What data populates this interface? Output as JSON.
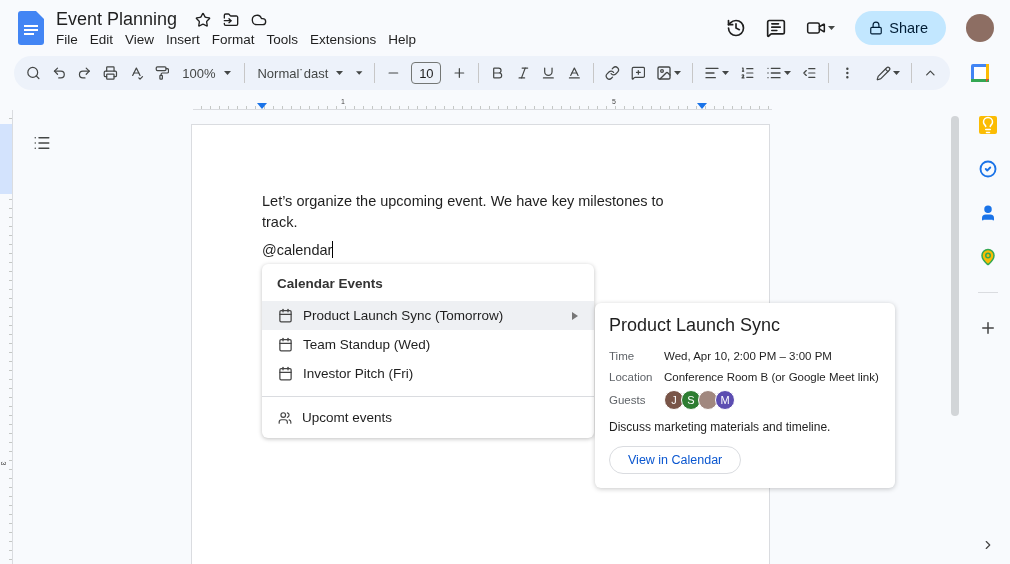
{
  "document": {
    "title": "Event Planning"
  },
  "menu": [
    "File",
    "Edit",
    "View",
    "Insert",
    "Format",
    "Tools",
    "Extensions",
    "Help"
  ],
  "toolbar": {
    "zoom": "100%",
    "style": "Normal˙dast",
    "font_size": "10"
  },
  "share": {
    "label": "Share"
  },
  "ruler": {
    "horizontal": [
      "1",
      "5"
    ],
    "vertical": [
      "3"
    ]
  },
  "body": {
    "paragraph": "Let’s organize the upcoming event. We have key milestones to track.",
    "mention_input": "@calendar"
  },
  "mention_menu": {
    "heading": "Calendar Events",
    "items": [
      {
        "label": "Product Launch Sync (Tomorrow)",
        "selected": true,
        "has_submenu": true
      },
      {
        "label": "Team Standup (Wed)",
        "selected": false,
        "has_submenu": false
      },
      {
        "label": "Investor Pitch (Fri)",
        "selected": false,
        "has_submenu": false
      }
    ],
    "footer": "Upcomt events"
  },
  "event_card": {
    "title": "Product Launch Sync",
    "fields": [
      {
        "label": "Time",
        "value": "Wed, Apr 10, 2:00 PM – 3:00 PM"
      },
      {
        "label": "Location",
        "value": "Conference Room B (or Google Meet link)"
      }
    ],
    "guests_label": "Guests",
    "guests": [
      {
        "kind": "initial",
        "initial": "J",
        "color": "#795548"
      },
      {
        "kind": "initial",
        "initial": "S",
        "color": "#2e7d32"
      },
      {
        "kind": "photo"
      },
      {
        "kind": "initial",
        "initial": "M",
        "color": "#5c4db1"
      }
    ],
    "description": "Discuss marketing materials and timeline.",
    "button": "View in Calendar"
  }
}
